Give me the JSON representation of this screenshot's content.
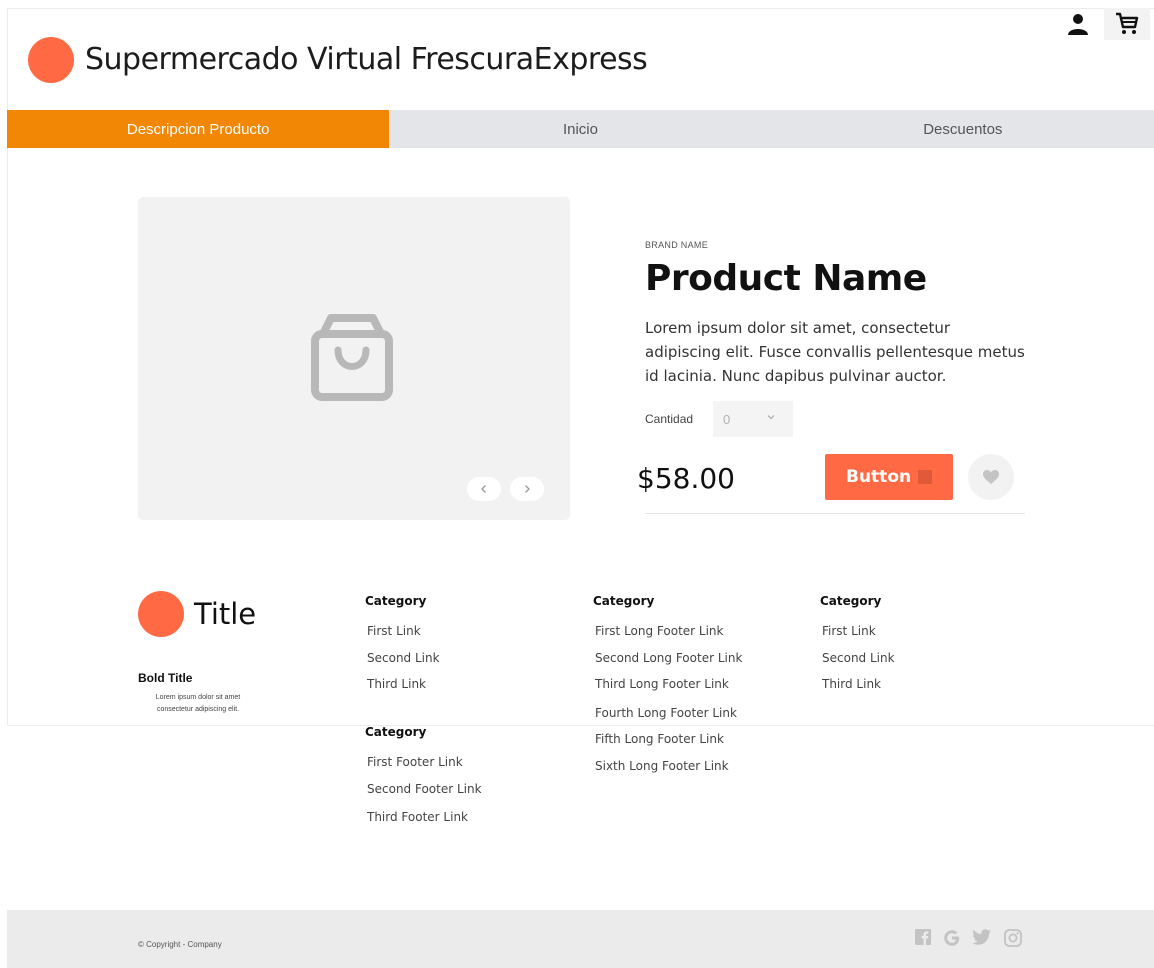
{
  "header": {
    "title": "Supermercado Virtual FrescuraExpress",
    "brand_color": "#ff6a44",
    "icons": [
      "user-icon",
      "cart-icon"
    ]
  },
  "nav": {
    "active_color": "#f28705",
    "tabs": [
      {
        "label": "Descripcion Producto",
        "active": true
      },
      {
        "label": "Inicio",
        "active": false
      },
      {
        "label": "Descuentos",
        "active": false
      }
    ]
  },
  "product": {
    "brand": "BRAND NAME",
    "name": "Product Name",
    "description": "Lorem ipsum dolor sit amet, consectetur adipiscing elit. Fusce convallis pellentesque metus id lacinia. Nunc dapibus pulvinar auctor.",
    "quantity_label": "Cantidad",
    "quantity_value": "0",
    "price": "$58.00",
    "button_label": "Button",
    "image_icon": "shopping-bag-icon"
  },
  "footer": {
    "title": "Title",
    "bold_title": "Bold Title",
    "small_text": "Lorem ipsum dolor sit amet consectetur adipiscing elit.",
    "columns": [
      {
        "heading": "Category",
        "links": [
          "First Link",
          "Second Link",
          "Third Link"
        ]
      },
      {
        "heading": "Category",
        "links": [
          "First Long Footer Link",
          "Second Long Footer Link",
          "Third Long Footer Link",
          "Fourth Long Footer Link",
          "Fifth Long Footer Link",
          "Sixth Long Footer Link"
        ]
      },
      {
        "heading": "Category",
        "links": [
          "First Link",
          "Second Link",
          "Third Link"
        ]
      },
      {
        "heading": "Category",
        "links": [
          "First Footer Link",
          "Second Footer Link",
          "Third Footer Link"
        ]
      }
    ],
    "copyright": "© Copyright - Company",
    "social_icons": [
      "facebook-icon",
      "google-icon",
      "twitter-icon",
      "instagram-icon"
    ]
  }
}
